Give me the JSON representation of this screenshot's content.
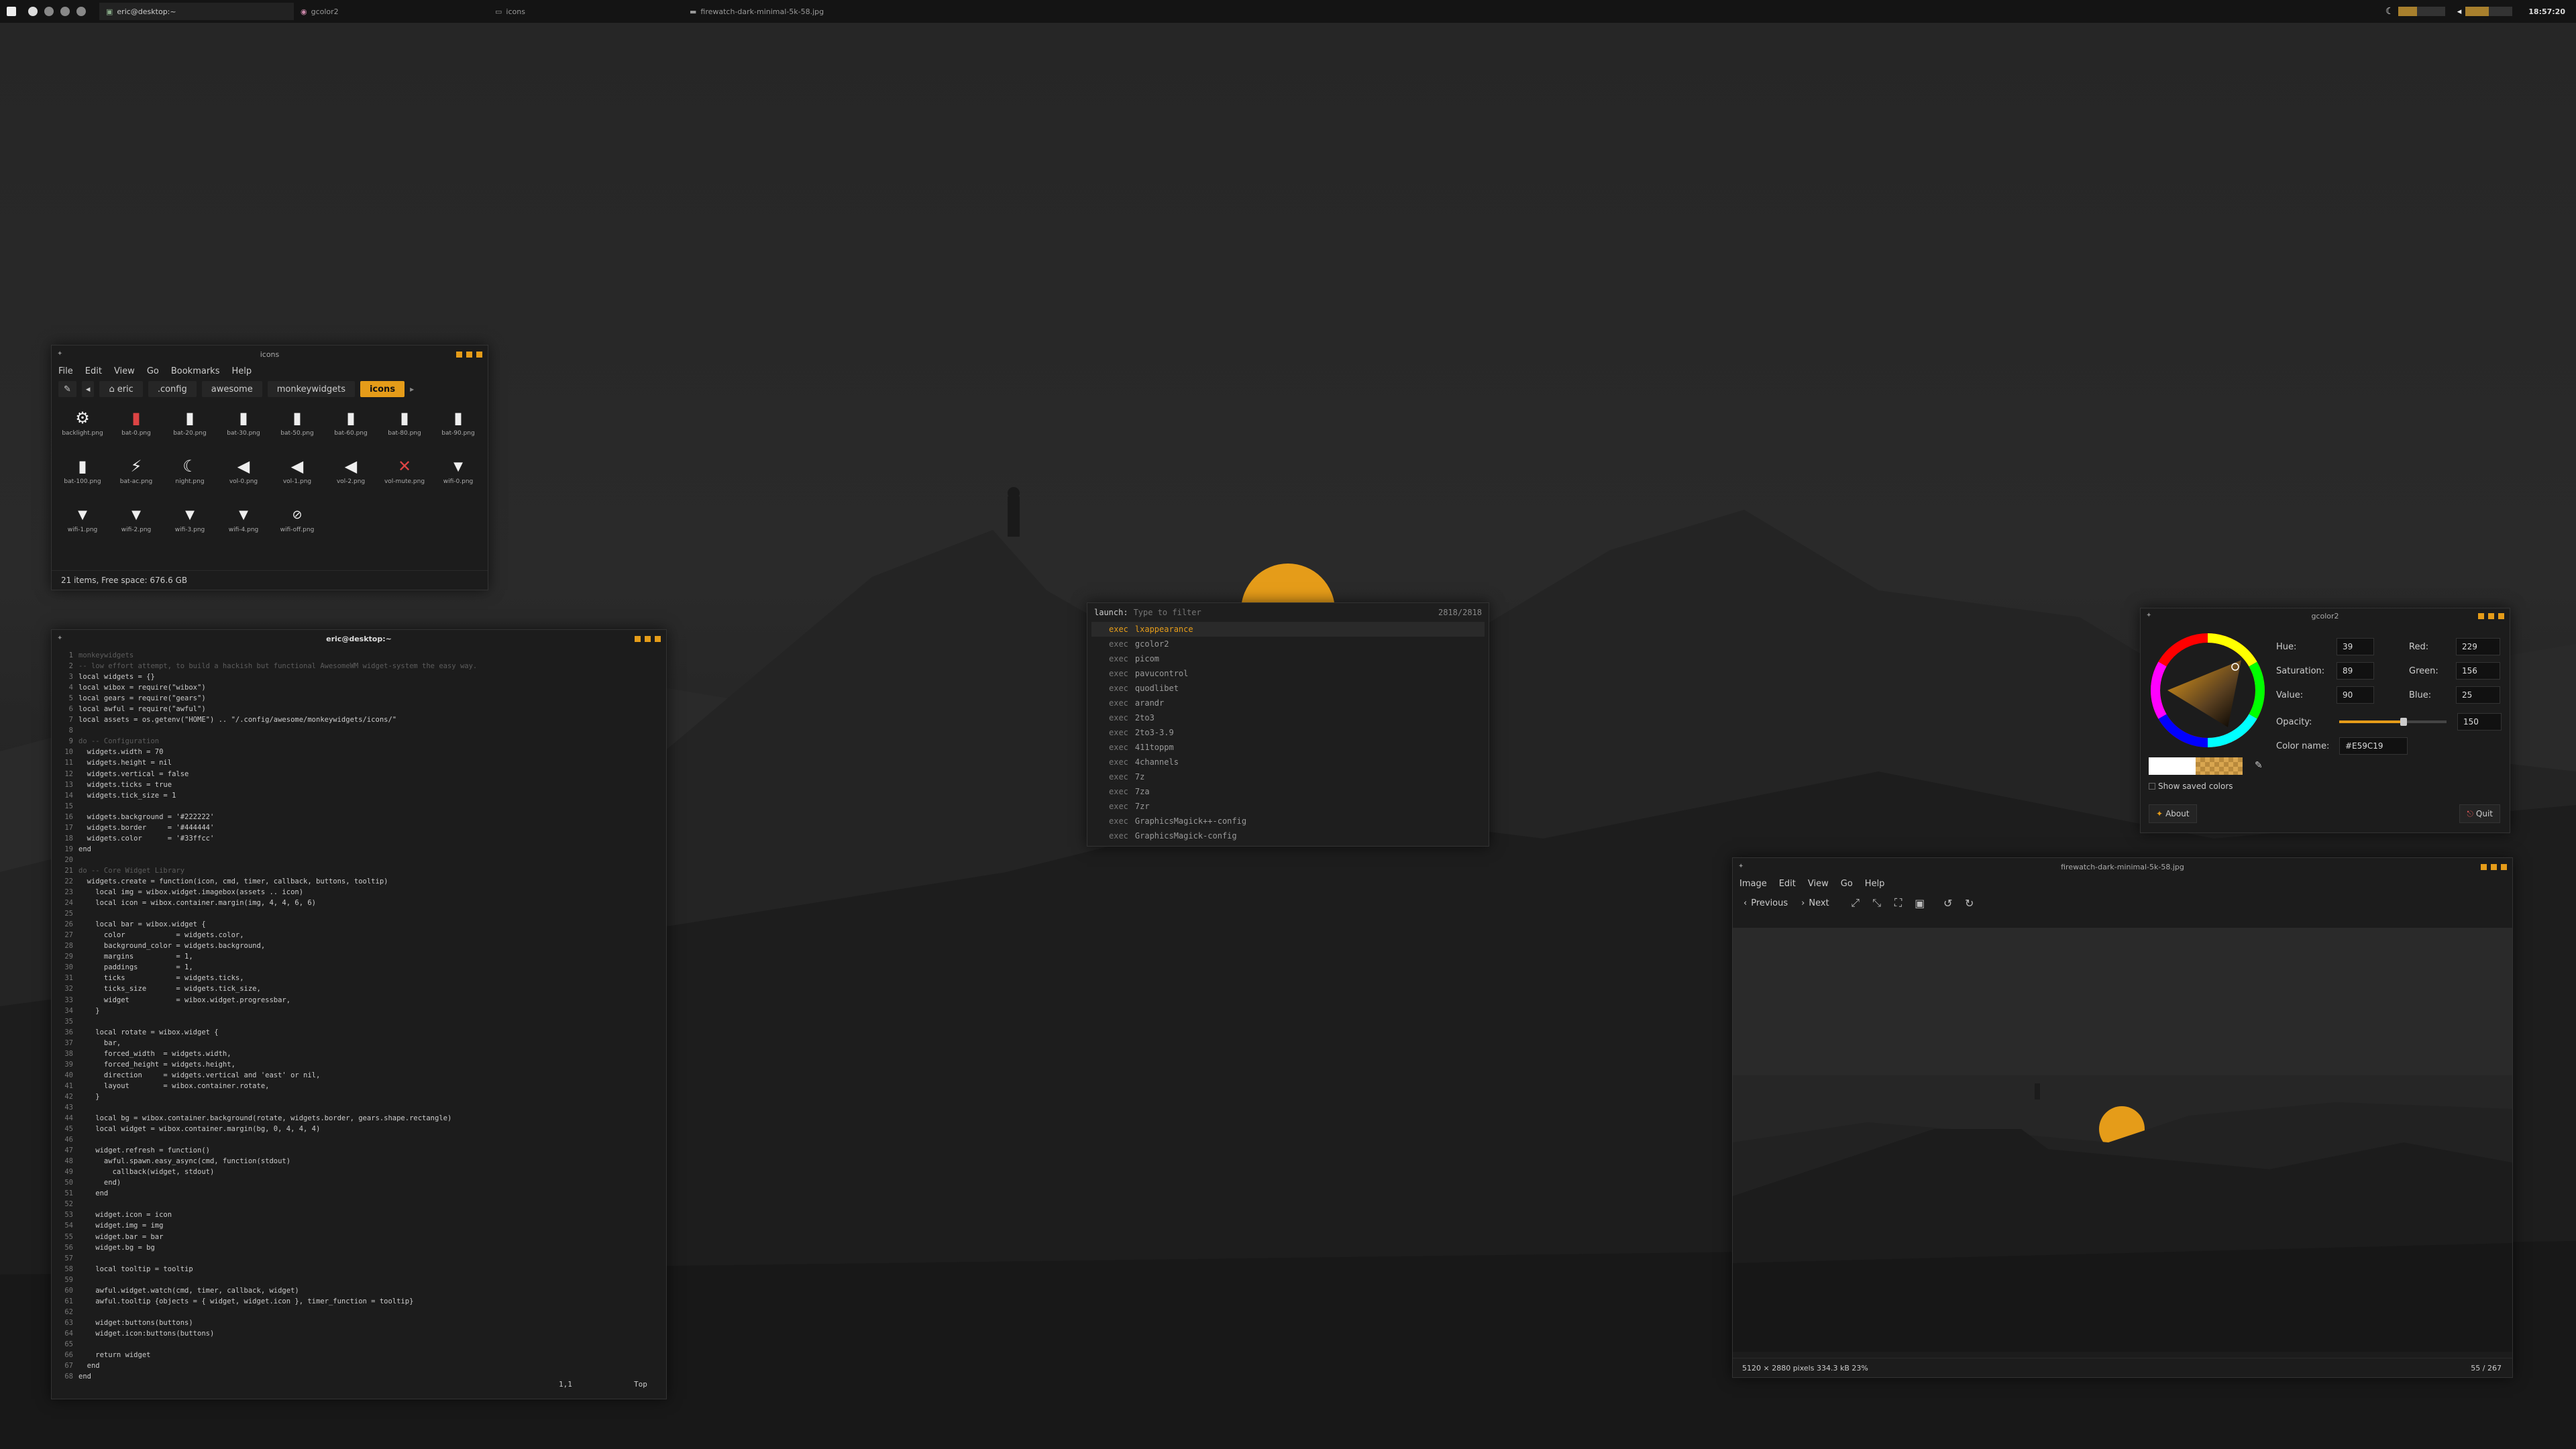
{
  "topbar": {
    "tasks": [
      {
        "label": "eric@desktop:~"
      },
      {
        "label": "gcolor2"
      },
      {
        "label": "icons"
      },
      {
        "label": "firewatch-dark-minimal-5k-58.jpg"
      }
    ],
    "clock": "18:57:20"
  },
  "filemanager": {
    "title": "icons",
    "menu": [
      "File",
      "Edit",
      "View",
      "Go",
      "Bookmarks",
      "Help"
    ],
    "breadcrumbs": [
      "eric",
      ".config",
      "awesome",
      "monkeywidgets",
      "icons"
    ],
    "files": [
      {
        "name": "backlight.png",
        "icon": "gear-icon"
      },
      {
        "name": "bat-0.png",
        "icon": "battery-empty-icon"
      },
      {
        "name": "bat-20.png",
        "icon": "battery-icon"
      },
      {
        "name": "bat-30.png",
        "icon": "battery-icon"
      },
      {
        "name": "bat-50.png",
        "icon": "battery-icon"
      },
      {
        "name": "bat-60.png",
        "icon": "battery-icon"
      },
      {
        "name": "bat-80.png",
        "icon": "battery-icon"
      },
      {
        "name": "bat-90.png",
        "icon": "battery-icon"
      },
      {
        "name": "bat-100.png",
        "icon": "battery-full-icon"
      },
      {
        "name": "bat-ac.png",
        "icon": "battery-charging-icon"
      },
      {
        "name": "night.png",
        "icon": "moon-icon"
      },
      {
        "name": "vol-0.png",
        "icon": "volume-icon"
      },
      {
        "name": "vol-1.png",
        "icon": "volume-icon"
      },
      {
        "name": "vol-2.png",
        "icon": "volume-icon"
      },
      {
        "name": "vol-mute.png",
        "icon": "volume-mute-icon"
      },
      {
        "name": "wifi-0.png",
        "icon": "wifi-icon"
      },
      {
        "name": "wifi-1.png",
        "icon": "wifi-icon"
      },
      {
        "name": "wifi-2.png",
        "icon": "wifi-icon"
      },
      {
        "name": "wifi-3.png",
        "icon": "wifi-icon"
      },
      {
        "name": "wifi-4.png",
        "icon": "wifi-icon"
      },
      {
        "name": "wifi-off.png",
        "icon": "wifi-off-icon"
      }
    ],
    "status": "21 items, Free space: 676.6 GB"
  },
  "terminal": {
    "title": "eric@desktop:~",
    "lines": [
      "monkeywidgets",
      "-- low effort attempt, to build a hackish but functional AwesomeWM widget-system the easy way.",
      "local widgets = {}",
      "local wibox = require(\"wibox\")",
      "local gears = require(\"gears\")",
      "local awful = require(\"awful\")",
      "local assets = os.getenv(\"HOME\") .. \"/.config/awesome/monkeywidgets/icons/\"",
      "",
      "do -- Configuration",
      "  widgets.width = 70",
      "  widgets.height = nil",
      "  widgets.vertical = false",
      "  widgets.ticks = true",
      "  widgets.tick_size = 1",
      "",
      "  widgets.background = '#222222'",
      "  widgets.border     = '#444444'",
      "  widgets.color      = '#33ffcc'",
      "end",
      "",
      "do -- Core Widget Library",
      "  widgets.create = function(icon, cmd, timer, callback, buttons, tooltip)",
      "    local img = wibox.widget.imagebox(assets .. icon)",
      "    local icon = wibox.container.margin(img, 4, 4, 6, 6)",
      "",
      "    local bar = wibox.widget {",
      "      color            = widgets.color,",
      "      background_color = widgets.background,",
      "      margins          = 1,",
      "      paddings         = 1,",
      "      ticks            = widgets.ticks,",
      "      ticks_size       = widgets.tick_size,",
      "      widget           = wibox.widget.progressbar,",
      "    }",
      "",
      "    local rotate = wibox.widget {",
      "      bar,",
      "      forced_width  = widgets.width,",
      "      forced_height = widgets.height,",
      "      direction     = widgets.vertical and 'east' or nil,",
      "      layout        = wibox.container.rotate,",
      "    }",
      "",
      "    local bg = wibox.container.background(rotate, widgets.border, gears.shape.rectangle)",
      "    local widget = wibox.container.margin(bg, 0, 4, 4, 4)",
      "",
      "    widget.refresh = function()",
      "      awful.spawn.easy_async(cmd, function(stdout)",
      "        callback(widget, stdout)",
      "      end)",
      "    end",
      "",
      "    widget.icon = icon",
      "    widget.img = img",
      "    widget.bar = bar",
      "    widget.bg = bg",
      "",
      "    local tooltip = tooltip",
      "",
      "    awful.widget.watch(cmd, timer, callback, widget)",
      "    awful.tooltip {objects = { widget, widget.icon }, timer_function = tooltip}",
      "",
      "    widget:buttons(buttons)",
      "    widget.icon:buttons(buttons)",
      "",
      "    return widget",
      "  end",
      "end"
    ],
    "cursor_pos": "1,1",
    "scroll_pos": "Top"
  },
  "launcher": {
    "prompt": "launch:",
    "placeholder": "Type to filter",
    "count": "2818/2818",
    "prefix": "exec",
    "items": [
      "lxappearance",
      "gcolor2",
      "picom",
      "pavucontrol",
      "quodlibet",
      "arandr",
      "2to3",
      "2to3-3.9",
      "411toppm",
      "4channels",
      "7z",
      "7za",
      "7zr",
      "GraphicsMagick++-config",
      "GraphicsMagick-config"
    ]
  },
  "gcolor": {
    "title": "gcolor2",
    "hue_label": "Hue:",
    "hue": "39",
    "saturation_label": "Saturation:",
    "saturation": "89",
    "value_label": "Value:",
    "value": "90",
    "red_label": "Red:",
    "red": "229",
    "green_label": "Green:",
    "green": "156",
    "blue_label": "Blue:",
    "blue": "25",
    "opacity_label": "Opacity:",
    "opacity": "150",
    "colorname_label": "Color name:",
    "colorname": "#E59C19",
    "show_saved": "Show saved colors",
    "about": "About",
    "quit": "Quit"
  },
  "imageviewer": {
    "title": "firewatch-dark-minimal-5k-58.jpg",
    "menu": [
      "Image",
      "Edit",
      "View",
      "Go",
      "Help"
    ],
    "prev": "Previous",
    "next": "Next",
    "status_info": "5120 × 2880 pixels  334.3 kB   23%",
    "status_count": "55 / 267"
  },
  "colors": {
    "accent": "#e59c19",
    "background": "#1c1c1c"
  }
}
